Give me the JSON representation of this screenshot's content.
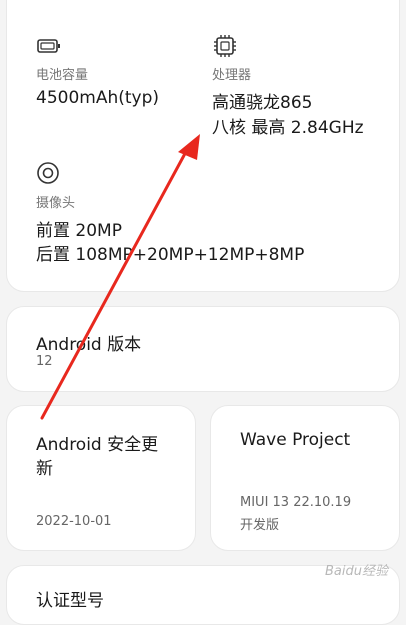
{
  "specs": {
    "battery": {
      "icon": "battery-icon",
      "label": "电池容量",
      "value": "4500mAh(typ)"
    },
    "processor": {
      "icon": "chip-icon",
      "label": "处理器",
      "line1": "高通骁龙865",
      "line2": "八核 最高 2.84GHz"
    },
    "camera": {
      "icon": "camera-lens-icon",
      "label": "摄像头",
      "line1": "前置 20MP",
      "line2": "后置 108MP+20MP+12MP+8MP"
    }
  },
  "android_version": {
    "title": "Android 版本",
    "value": "12"
  },
  "security_update": {
    "title_line1": "Android 安全更",
    "title_line2": "新",
    "value": "2022-10-01"
  },
  "wave_project": {
    "title": "Wave Project",
    "value_line1": "MIUI 13 22.10.19",
    "value_line2": "开发版"
  },
  "bottom_card": {
    "title": "认证型号"
  },
  "watermark": "Baidu经验",
  "colors": {
    "annotation_arrow": "#e8281e",
    "card_bg": "#ffffff",
    "page_bg": "#f4f4f4"
  }
}
